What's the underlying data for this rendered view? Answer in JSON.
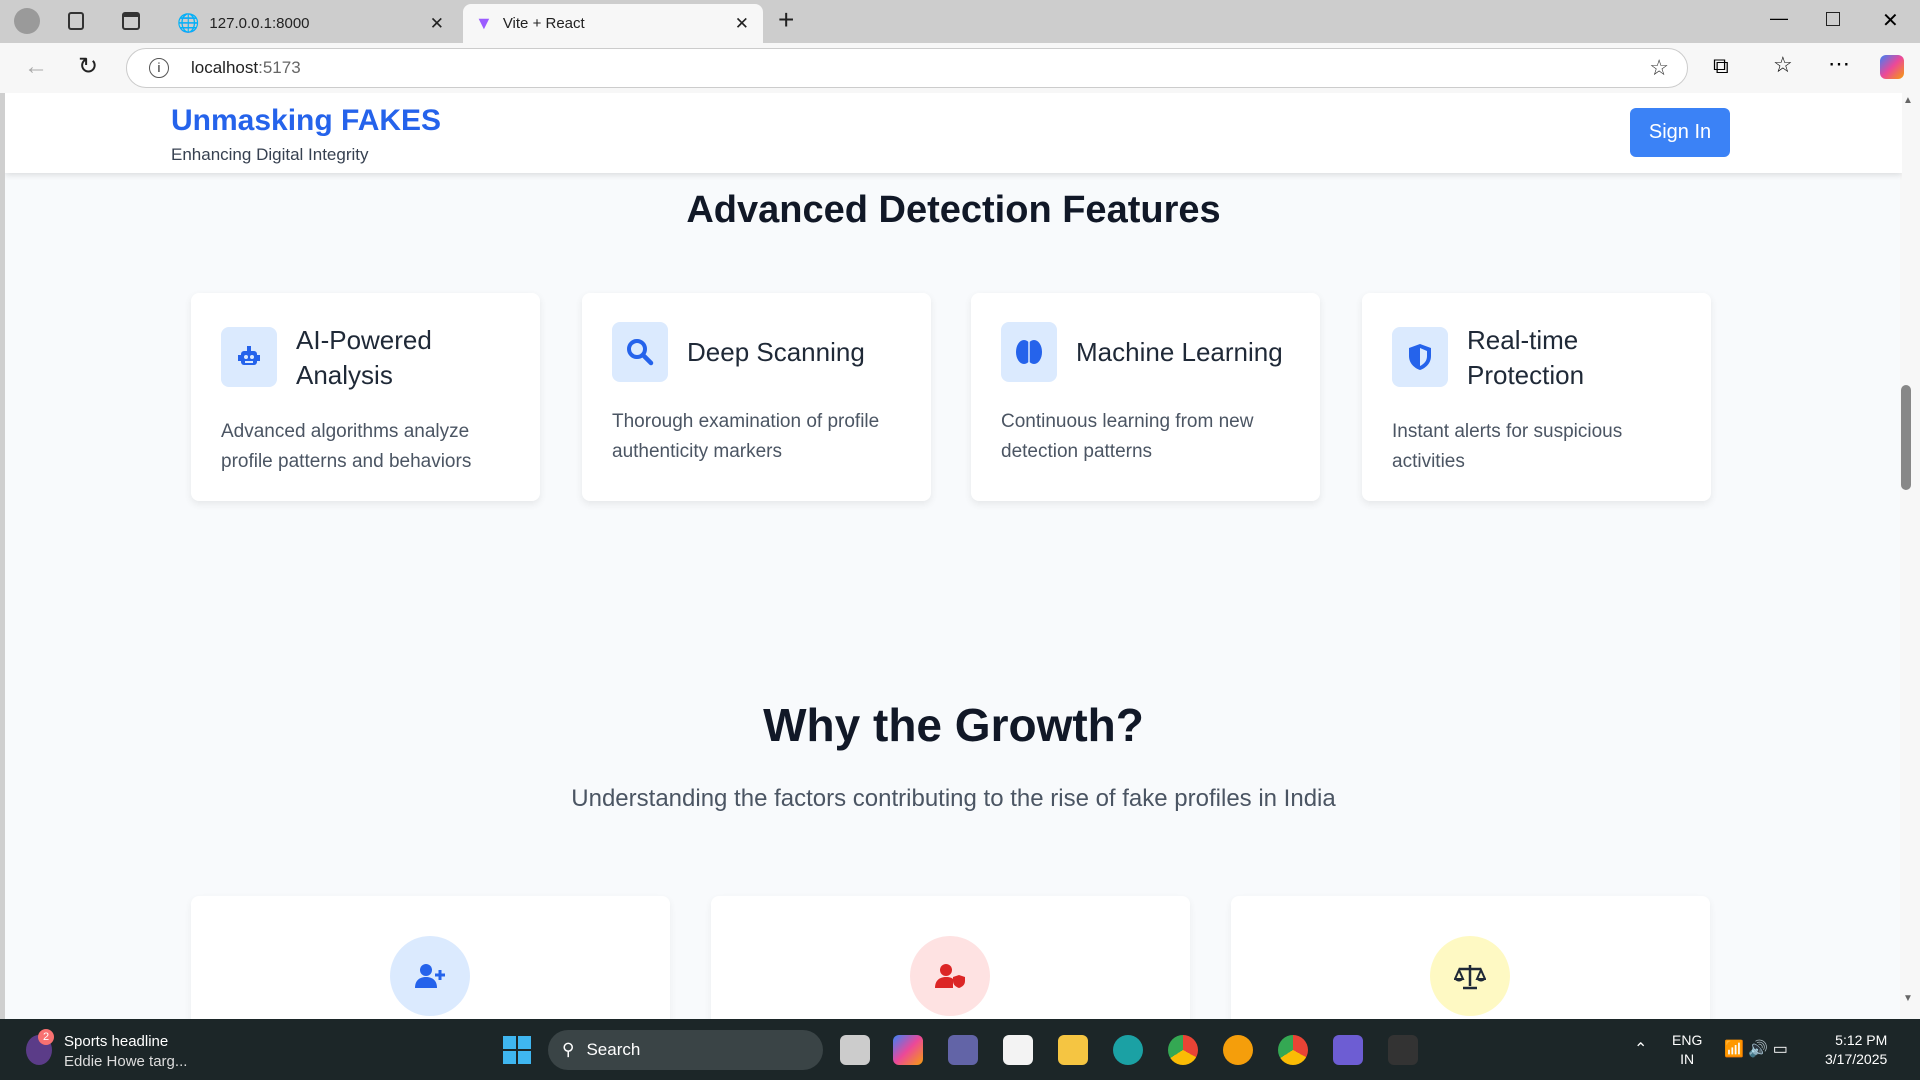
{
  "browser": {
    "tabs": [
      {
        "label": "127.0.0.1:8000",
        "icon": "globe-icon"
      },
      {
        "label": "Vite + React",
        "icon": "vite-icon",
        "active": true
      }
    ],
    "url_host": "localhost",
    "url_port": ":5173"
  },
  "header": {
    "brand": "Unmasking FAKES",
    "tagline": "Enhancing Digital Integrity",
    "sign_in": "Sign In"
  },
  "features": {
    "title": "Advanced Detection Features",
    "items": [
      {
        "icon": "robot-icon",
        "title": "AI-Powered Analysis",
        "desc": "Advanced algorithms analyze profile patterns and behaviors"
      },
      {
        "icon": "search-icon",
        "title": "Deep Scanning",
        "desc": "Thorough examination of profile authenticity markers"
      },
      {
        "icon": "brain-icon",
        "title": "Machine Learning",
        "desc": "Continuous learning from new detection patterns"
      },
      {
        "icon": "shield-icon",
        "title": "Real-time Protection",
        "desc": "Instant alerts for suspicious activities"
      }
    ]
  },
  "growth": {
    "title": "Why the Growth?",
    "subtitle": "Understanding the factors contributing to the rise of fake profiles in India",
    "cards": [
      {
        "icon": "user-plus-icon",
        "color": "#dbeafe"
      },
      {
        "icon": "user-shield-icon",
        "color": "#fee2e2"
      },
      {
        "icon": "scale-balance-icon",
        "color": "#fef9c3"
      }
    ]
  },
  "colors": {
    "accent": "#2563eb",
    "button": "#3b82f6"
  },
  "taskbar": {
    "news_badge": "2",
    "news_title": "Sports headline",
    "news_text": "Eddie Howe targ...",
    "search": "Search",
    "lang": "ENG",
    "region": "IN",
    "time": "5:12 PM",
    "date": "3/17/2025"
  }
}
